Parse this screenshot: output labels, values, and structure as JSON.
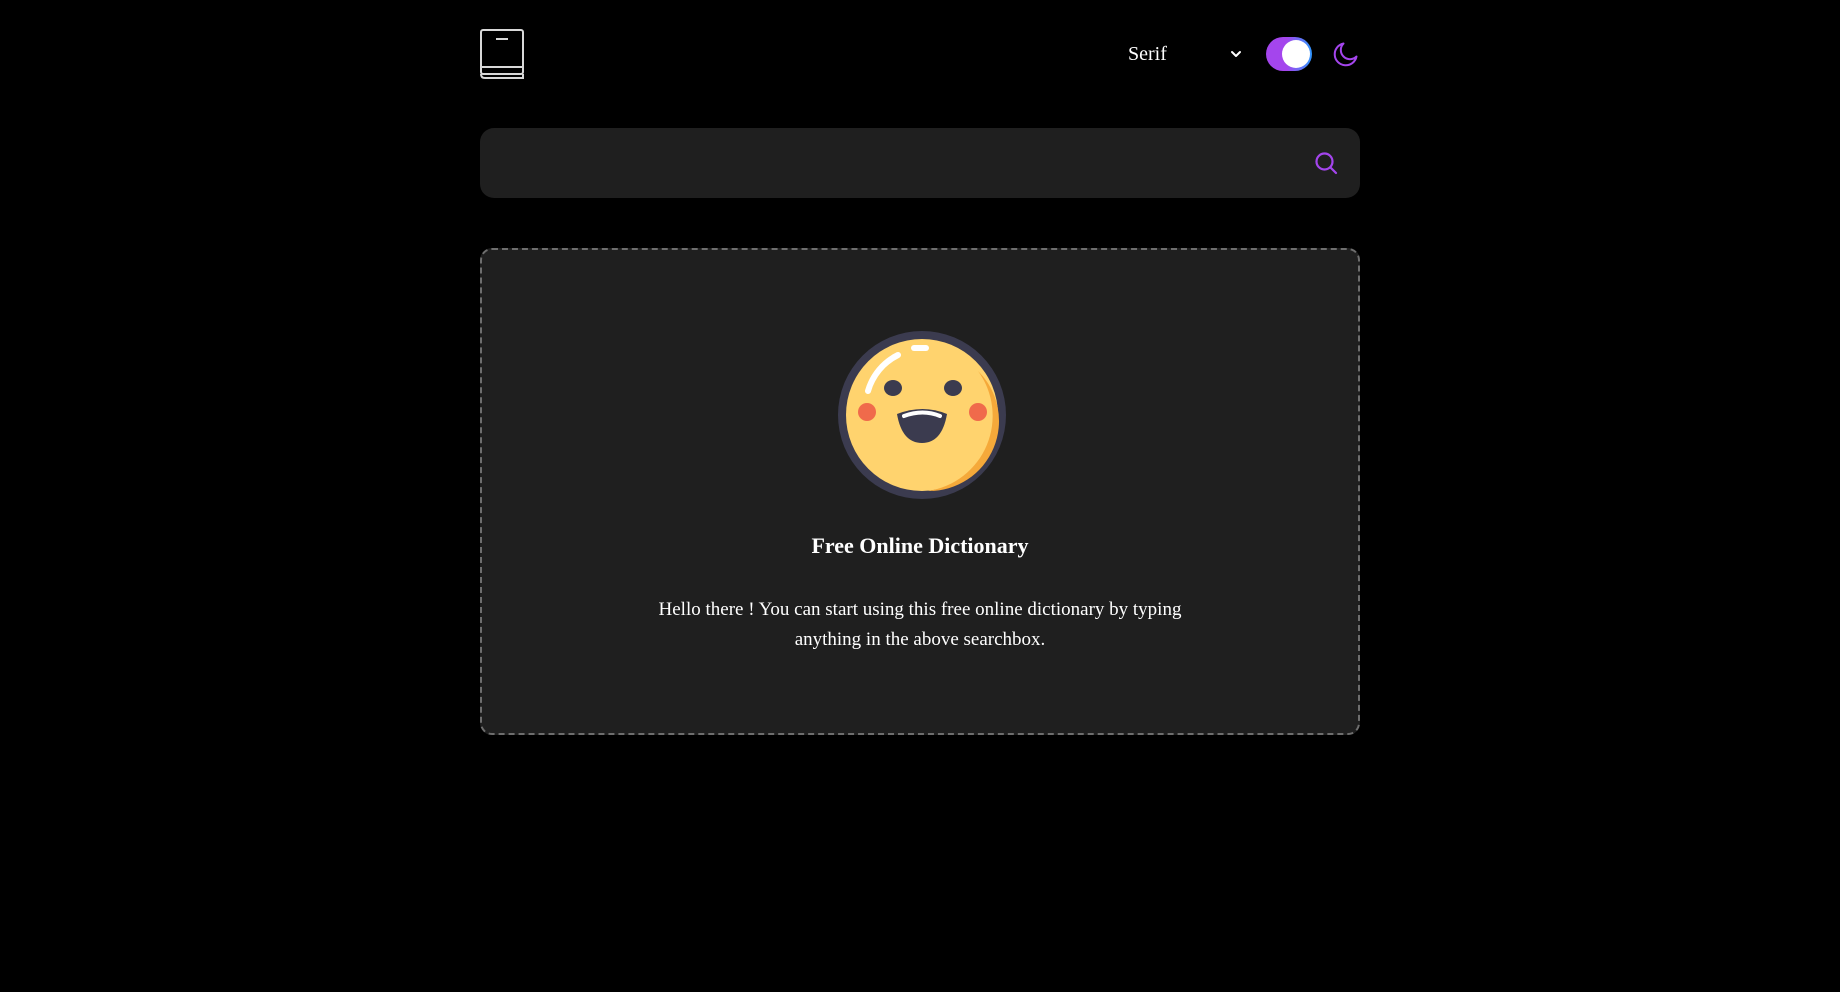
{
  "header": {
    "logo_icon": "book-icon",
    "font_select": {
      "selected": "Serif",
      "icon": "chevron-down-icon"
    },
    "theme_toggle": {
      "state": "on",
      "icon": "moon-icon"
    }
  },
  "search": {
    "value": "",
    "placeholder": "",
    "icon": "search-icon"
  },
  "welcome": {
    "icon": "smiley-emoji-icon",
    "title": "Free Online Dictionary",
    "message": "Hello there ! You can start using this free online dictionary by typing anything in the above searchbox."
  },
  "colors": {
    "background": "#000000",
    "surface": "#1f1f1f",
    "accent": "#a445ed",
    "text": "#ffffff"
  }
}
